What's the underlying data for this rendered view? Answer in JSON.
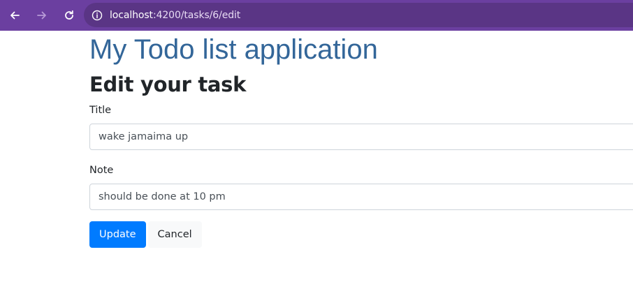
{
  "browser": {
    "url_host": "localhost",
    "url_path": ":4200/tasks/6/edit",
    "icons": [
      "back-arrow-icon",
      "forward-arrow-icon",
      "reload-icon",
      "site-info-icon"
    ],
    "colors": {
      "toolbar": "#6b3fa0",
      "omnibox": "#5a3585"
    }
  },
  "app": {
    "title": "My Todo list application",
    "title_color": "#336699"
  },
  "form": {
    "heading": "Edit your task",
    "title_label": "Title",
    "title_value": "wake jamaima up",
    "note_label": "Note",
    "note_value": "should be done at 10 pm",
    "update_label": "Update",
    "cancel_label": "Cancel",
    "colors": {
      "primary": "#007bff",
      "light": "#f8f9fa"
    }
  }
}
